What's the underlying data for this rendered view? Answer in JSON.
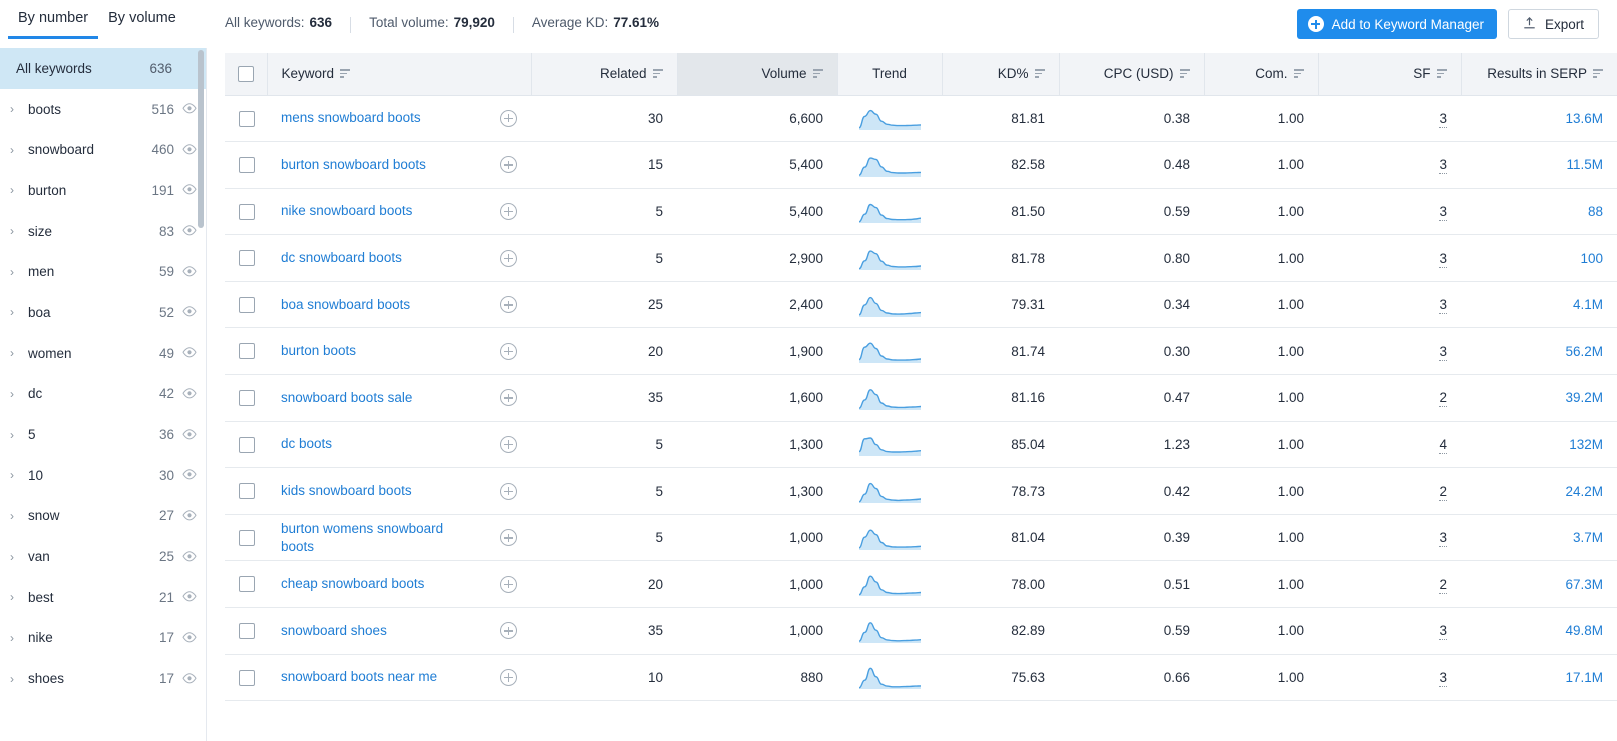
{
  "tabs": [
    {
      "label": "By number",
      "active": true
    },
    {
      "label": "By volume",
      "active": false
    }
  ],
  "summary": {
    "all_keywords_label": "All keywords:",
    "all_keywords_value": "636",
    "total_volume_label": "Total volume:",
    "total_volume_value": "79,920",
    "average_kd_label": "Average KD:",
    "average_kd_value": "77.61%"
  },
  "toolbar": {
    "add_to_keyword_manager": "Add to Keyword Manager",
    "export": "Export"
  },
  "sidebar": {
    "all": {
      "label": "All keywords",
      "count": "636"
    },
    "items": [
      {
        "label": "boots",
        "count": "516"
      },
      {
        "label": "snowboard",
        "count": "460"
      },
      {
        "label": "burton",
        "count": "191"
      },
      {
        "label": "size",
        "count": "83"
      },
      {
        "label": "men",
        "count": "59"
      },
      {
        "label": "boa",
        "count": "52"
      },
      {
        "label": "women",
        "count": "49"
      },
      {
        "label": "dc",
        "count": "42"
      },
      {
        "label": "5",
        "count": "36"
      },
      {
        "label": "10",
        "count": "30"
      },
      {
        "label": "snow",
        "count": "27"
      },
      {
        "label": "van",
        "count": "25"
      },
      {
        "label": "best",
        "count": "21"
      },
      {
        "label": "nike",
        "count": "17"
      },
      {
        "label": "shoes",
        "count": "17"
      }
    ]
  },
  "table": {
    "columns": [
      {
        "key": "keyword",
        "label": "Keyword",
        "align": "left",
        "sortable": true
      },
      {
        "key": "related",
        "label": "Related",
        "align": "right",
        "sortable": true
      },
      {
        "key": "volume",
        "label": "Volume",
        "align": "right",
        "sortable": true,
        "highlighted": true
      },
      {
        "key": "trend",
        "label": "Trend",
        "align": "center",
        "sortable": false
      },
      {
        "key": "kd",
        "label": "KD%",
        "align": "right",
        "sortable": true
      },
      {
        "key": "cpc",
        "label": "CPC (USD)",
        "align": "right",
        "sortable": true
      },
      {
        "key": "com",
        "label": "Com.",
        "align": "right",
        "sortable": true
      },
      {
        "key": "sf",
        "label": "SF",
        "align": "right",
        "sortable": true
      },
      {
        "key": "serp",
        "label": "Results in SERP",
        "align": "right",
        "sortable": true
      }
    ],
    "rows": [
      {
        "keyword": "mens snowboard boots",
        "related": "30",
        "volume": "6,600",
        "kd": "81.81",
        "cpc": "0.38",
        "com": "1.00",
        "sf": "3",
        "serp": "13.6M",
        "trend": [
          0.1,
          0.62,
          0.88,
          0.72,
          0.4,
          0.26,
          0.22,
          0.2,
          0.2,
          0.21,
          0.22,
          0.23
        ]
      },
      {
        "keyword": "burton snowboard boots",
        "related": "15",
        "volume": "5,400",
        "kd": "82.58",
        "cpc": "0.48",
        "com": "1.00",
        "sf": "3",
        "serp": "11.5M",
        "trend": [
          0.08,
          0.45,
          0.86,
          0.8,
          0.46,
          0.26,
          0.2,
          0.18,
          0.18,
          0.19,
          0.2,
          0.21
        ]
      },
      {
        "keyword": "nike snowboard boots",
        "related": "5",
        "volume": "5,400",
        "kd": "81.50",
        "cpc": "0.59",
        "com": "1.00",
        "sf": "3",
        "serp": "88",
        "trend": [
          0.06,
          0.4,
          0.84,
          0.7,
          0.36,
          0.2,
          0.16,
          0.15,
          0.15,
          0.16,
          0.18,
          0.22
        ]
      },
      {
        "keyword": "dc snowboard boots",
        "related": "5",
        "volume": "2,900",
        "kd": "81.78",
        "cpc": "0.80",
        "com": "1.00",
        "sf": "3",
        "serp": "100",
        "trend": [
          0.06,
          0.42,
          0.86,
          0.74,
          0.4,
          0.22,
          0.16,
          0.14,
          0.14,
          0.15,
          0.16,
          0.18
        ]
      },
      {
        "keyword": "boa snowboard boots",
        "related": "25",
        "volume": "2,400",
        "kd": "79.31",
        "cpc": "0.34",
        "com": "1.00",
        "sf": "3",
        "serp": "4.1M",
        "trend": [
          0.1,
          0.55,
          0.88,
          0.62,
          0.3,
          0.18,
          0.14,
          0.13,
          0.14,
          0.16,
          0.18,
          0.2
        ]
      },
      {
        "keyword": "burton boots",
        "related": "20",
        "volume": "1,900",
        "kd": "81.74",
        "cpc": "0.30",
        "com": "1.00",
        "sf": "3",
        "serp": "56.2M",
        "trend": [
          0.16,
          0.72,
          0.9,
          0.66,
          0.32,
          0.18,
          0.14,
          0.13,
          0.13,
          0.14,
          0.16,
          0.18
        ]
      },
      {
        "keyword": "snowboard boots sale",
        "related": "35",
        "volume": "1,600",
        "kd": "81.16",
        "cpc": "0.47",
        "com": "1.00",
        "sf": "2",
        "serp": "39.2M",
        "trend": [
          0.08,
          0.46,
          0.92,
          0.7,
          0.32,
          0.18,
          0.13,
          0.12,
          0.12,
          0.13,
          0.14,
          0.16
        ]
      },
      {
        "keyword": "dc boots",
        "related": "5",
        "volume": "1,300",
        "kd": "85.04",
        "cpc": "1.23",
        "com": "1.00",
        "sf": "4",
        "serp": "132M",
        "trend": [
          0.2,
          0.78,
          0.82,
          0.52,
          0.28,
          0.2,
          0.18,
          0.18,
          0.19,
          0.2,
          0.22,
          0.24
        ]
      },
      {
        "keyword": "kids snowboard boots",
        "related": "5",
        "volume": "1,300",
        "kd": "78.73",
        "cpc": "0.42",
        "com": "1.00",
        "sf": "2",
        "serp": "24.2M",
        "trend": [
          0.06,
          0.4,
          0.88,
          0.66,
          0.3,
          0.17,
          0.13,
          0.12,
          0.13,
          0.14,
          0.16,
          0.18
        ]
      },
      {
        "keyword": "burton womens snowboard boots",
        "related": "5",
        "volume": "1,000",
        "kd": "81.04",
        "cpc": "0.39",
        "com": "1.00",
        "sf": "3",
        "serp": "3.7M",
        "trend": [
          0.1,
          0.58,
          0.9,
          0.7,
          0.34,
          0.18,
          0.14,
          0.13,
          0.13,
          0.14,
          0.15,
          0.17
        ]
      },
      {
        "keyword": "cheap snowboard boots",
        "related": "20",
        "volume": "1,000",
        "kd": "78.00",
        "cpc": "0.51",
        "com": "1.00",
        "sf": "2",
        "serp": "67.3M",
        "trend": [
          0.06,
          0.42,
          0.9,
          0.64,
          0.28,
          0.16,
          0.12,
          0.11,
          0.12,
          0.13,
          0.14,
          0.16
        ]
      },
      {
        "keyword": "snowboard shoes",
        "related": "35",
        "volume": "1,000",
        "kd": "82.89",
        "cpc": "0.59",
        "com": "1.00",
        "sf": "3",
        "serp": "49.8M",
        "trend": [
          0.08,
          0.48,
          0.92,
          0.58,
          0.24,
          0.14,
          0.11,
          0.1,
          0.11,
          0.12,
          0.13,
          0.15
        ]
      },
      {
        "keyword": "snowboard boots near me",
        "related": "10",
        "volume": "880",
        "kd": "75.63",
        "cpc": "0.66",
        "com": "1.00",
        "sf": "3",
        "serp": "17.1M",
        "trend": [
          0.06,
          0.4,
          0.94,
          0.56,
          0.22,
          0.13,
          0.1,
          0.1,
          0.11,
          0.12,
          0.13,
          0.14
        ]
      }
    ]
  },
  "colors": {
    "accent": "#1f8cec",
    "link": "#1f7dd4",
    "sidebar_selected": "#cfe7f5",
    "trend_stroke": "#4a9fe0",
    "trend_fill": "#cde6f7",
    "header_bg": "#f2f4f7",
    "header_highlight_bg": "#e3e7eb"
  },
  "icons": {
    "add_circle": "plus-circle-icon",
    "export": "upload-icon",
    "eye": "eye-icon",
    "caret": "chevron-right-icon",
    "sort": "sort-icon"
  }
}
